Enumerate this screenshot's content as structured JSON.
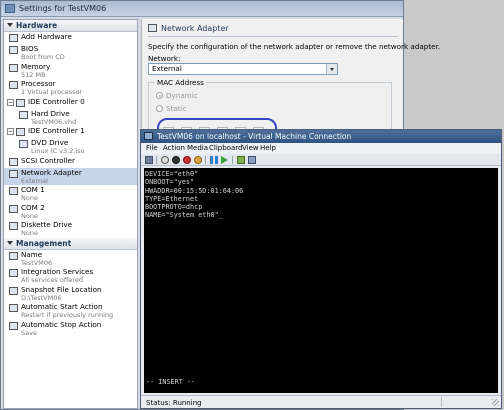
{
  "settings": {
    "title": "Settings for TestVM06",
    "hardware_header": "Hardware",
    "management_header": "Management",
    "hardware_items": [
      {
        "name": "Add Hardware",
        "sub": ""
      },
      {
        "name": "BIOS",
        "sub": "Boot from CD"
      },
      {
        "name": "Memory",
        "sub": "512 MB"
      },
      {
        "name": "Processor",
        "sub": "1 Virtual processor"
      },
      {
        "name": "IDE Controller 0",
        "sub": ""
      },
      {
        "name": "Hard Drive",
        "sub": "TestVM06.vhd"
      },
      {
        "name": "IDE Controller 1",
        "sub": ""
      },
      {
        "name": "DVD Drive",
        "sub": "Linux IC v3.2.iso"
      },
      {
        "name": "SCSI Controller",
        "sub": ""
      },
      {
        "name": "Network Adapter",
        "sub": "External"
      },
      {
        "name": "COM 1",
        "sub": "None"
      },
      {
        "name": "COM 2",
        "sub": "None"
      },
      {
        "name": "Diskette Drive",
        "sub": "None"
      }
    ],
    "management_items": [
      {
        "name": "Name",
        "sub": "TestVM06"
      },
      {
        "name": "Integration Services",
        "sub": "All services offered"
      },
      {
        "name": "Snapshot File Location",
        "sub": "D:\\TestVM06"
      },
      {
        "name": "Automatic Start Action",
        "sub": "Restart if previously running"
      },
      {
        "name": "Automatic Stop Action",
        "sub": "Save"
      }
    ],
    "network_adapter": {
      "heading": "Network Adapter",
      "description": "Specify the configuration of the network adapter or remove the network adapter.",
      "network_label": "Network:",
      "network_value": "External",
      "mac_group_label": "MAC Address",
      "dynamic_label": "Dynamic",
      "static_label": "Static",
      "mac_octets": [
        "00",
        "15",
        "5D",
        "01",
        "64",
        "06"
      ]
    }
  },
  "vm": {
    "title": "TestVM06 on localhost - Virtual Machine Connection",
    "menu": [
      "File",
      "Action",
      "Media",
      "Clipboard",
      "View",
      "Help"
    ],
    "console_lines": [
      "DEVICE=\"eth0\"",
      "ONBOOT=\"yes\"",
      "HWADDR=00:15:5D:01:64:06",
      "TYPE=Ethernet",
      "BOOTPROTO=dhcp",
      "NAME=\"System eth0\"_"
    ],
    "insert_mode": "-- INSERT --",
    "status": "Status: Running",
    "colors": {
      "titlebar": "#2f5383",
      "console_bg": "#000000",
      "console_fg": "#d2d2d2",
      "highlight_oval": "#3547c9"
    }
  }
}
